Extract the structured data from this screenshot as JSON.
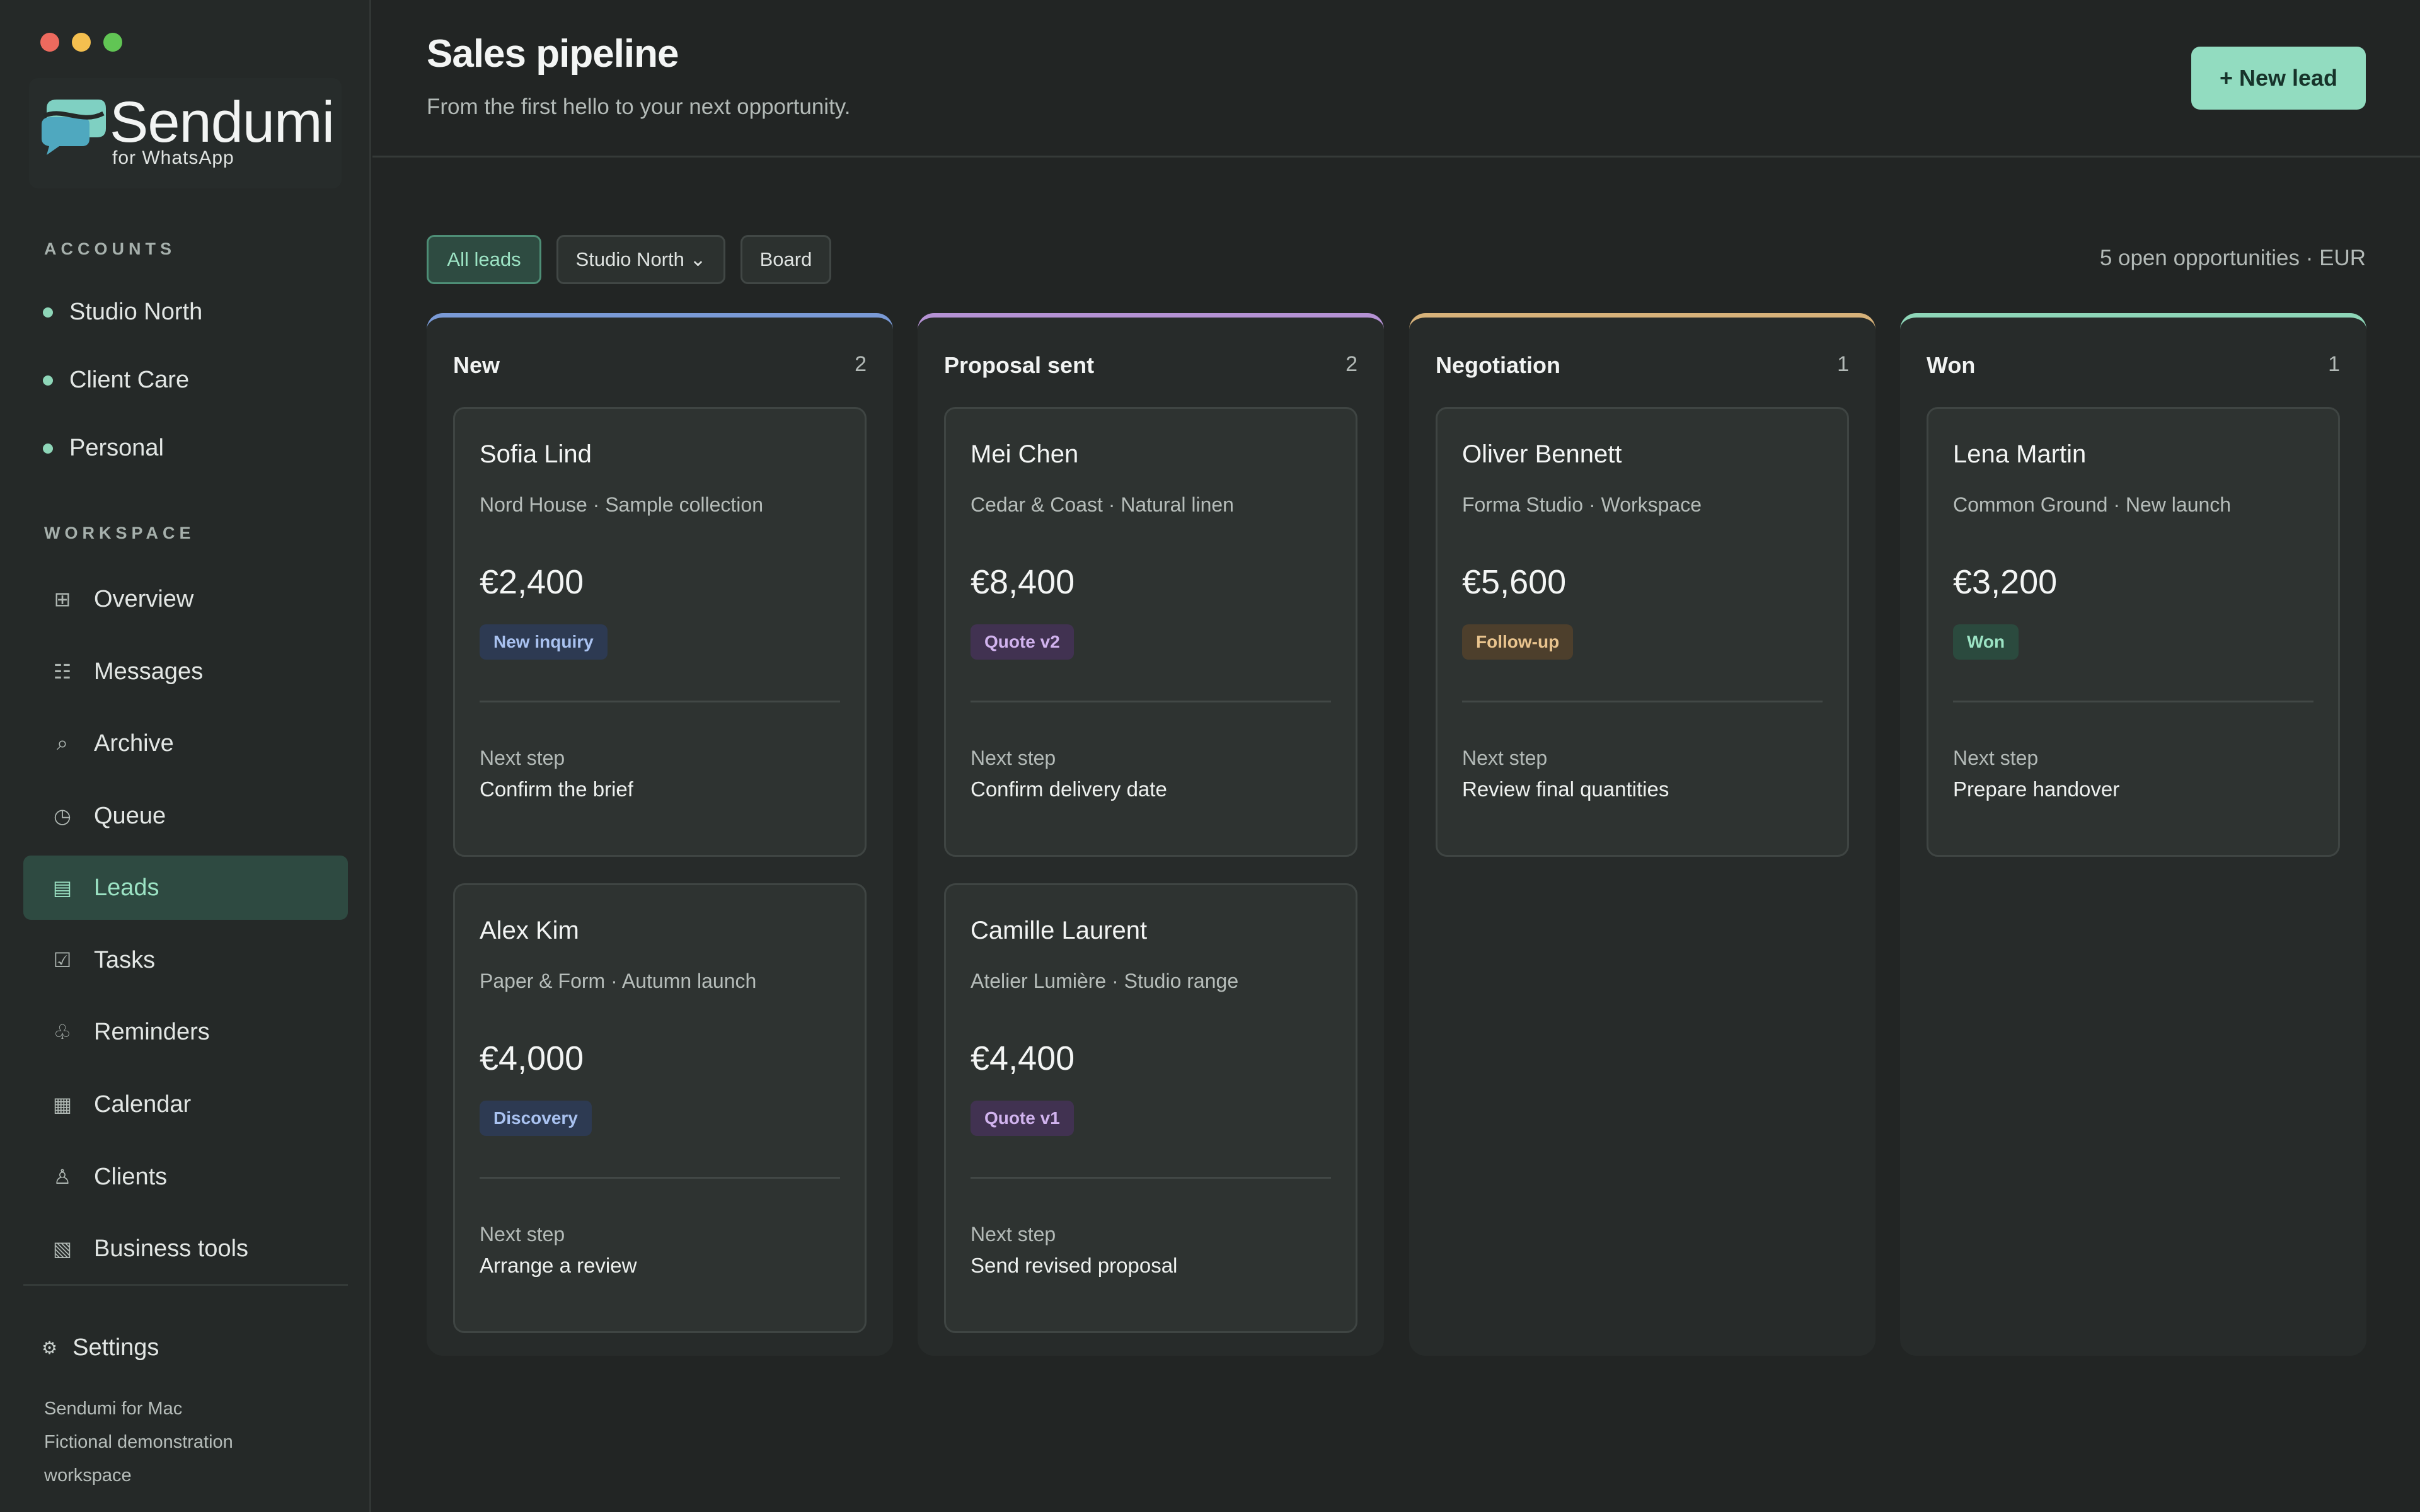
{
  "colors": {
    "accent": "#92dcc0",
    "traffic": [
      "#ed6a5e",
      "#f4bf4f",
      "#61c554"
    ],
    "col_new": "#7a9ad6",
    "col_proposal": "#b592d4",
    "col_negotiation": "#d7b27a",
    "col_won": "#8ed6b8"
  },
  "brand": {
    "name": "Sendumi",
    "sub": "for WhatsApp"
  },
  "sidebar": {
    "accounts_label": "ACCOUNTS",
    "accounts": [
      {
        "label": "Studio North"
      },
      {
        "label": "Client Care"
      },
      {
        "label": "Personal"
      }
    ],
    "workspace_label": "WORKSPACE",
    "items": [
      {
        "label": "Overview",
        "icon": "grid-icon"
      },
      {
        "label": "Messages",
        "icon": "list-icon"
      },
      {
        "label": "Archive",
        "icon": "search-icon"
      },
      {
        "label": "Queue",
        "icon": "clock-icon"
      },
      {
        "label": "Leads",
        "icon": "table-icon",
        "active": true
      },
      {
        "label": "Tasks",
        "icon": "checkbox-icon"
      },
      {
        "label": "Reminders",
        "icon": "bell-icon"
      },
      {
        "label": "Calendar",
        "icon": "calendar-icon"
      },
      {
        "label": "Clients",
        "icon": "person-icon"
      },
      {
        "label": "Business tools",
        "icon": "tools-icon"
      }
    ],
    "settings_label": "Settings",
    "footer_line1": "Sendumi for Mac",
    "footer_line2": "Fictional demonstration workspace"
  },
  "header": {
    "title": "Sales pipeline",
    "subtitle": "From the first hello to your next opportunity.",
    "new_lead_label": "+ New lead"
  },
  "filters": {
    "all_leads": "All leads",
    "account": "Studio North ⌄",
    "view": "Board",
    "summary": "5 open opportunities · EUR"
  },
  "board": {
    "next_step_label": "Next step",
    "columns": [
      {
        "title": "New",
        "count": "2",
        "cards": [
          {
            "name": "Sofia Lind",
            "meta": "Nord House · Sample collection",
            "amount": "€2,400",
            "tag": "New inquiry",
            "next": "Confirm the brief"
          },
          {
            "name": "Alex Kim",
            "meta": "Paper & Form · Autumn launch",
            "amount": "€4,000",
            "tag": "Discovery",
            "next": "Arrange a review"
          }
        ]
      },
      {
        "title": "Proposal sent",
        "count": "2",
        "cards": [
          {
            "name": "Mei Chen",
            "meta": "Cedar & Coast · Natural linen",
            "amount": "€8,400",
            "tag": "Quote v2",
            "next": "Confirm delivery date"
          },
          {
            "name": "Camille Laurent",
            "meta": "Atelier Lumière · Studio range",
            "amount": "€4,400",
            "tag": "Quote v1",
            "next": "Send revised proposal"
          }
        ]
      },
      {
        "title": "Negotiation",
        "count": "1",
        "cards": [
          {
            "name": "Oliver Bennett",
            "meta": "Forma Studio · Workspace",
            "amount": "€5,600",
            "tag": "Follow-up",
            "next": "Review final quantities"
          }
        ]
      },
      {
        "title": "Won",
        "count": "1",
        "cards": [
          {
            "name": "Lena Martin",
            "meta": "Common Ground · New launch",
            "amount": "€3,200",
            "tag": "Won",
            "next": "Prepare handover"
          }
        ]
      }
    ]
  }
}
